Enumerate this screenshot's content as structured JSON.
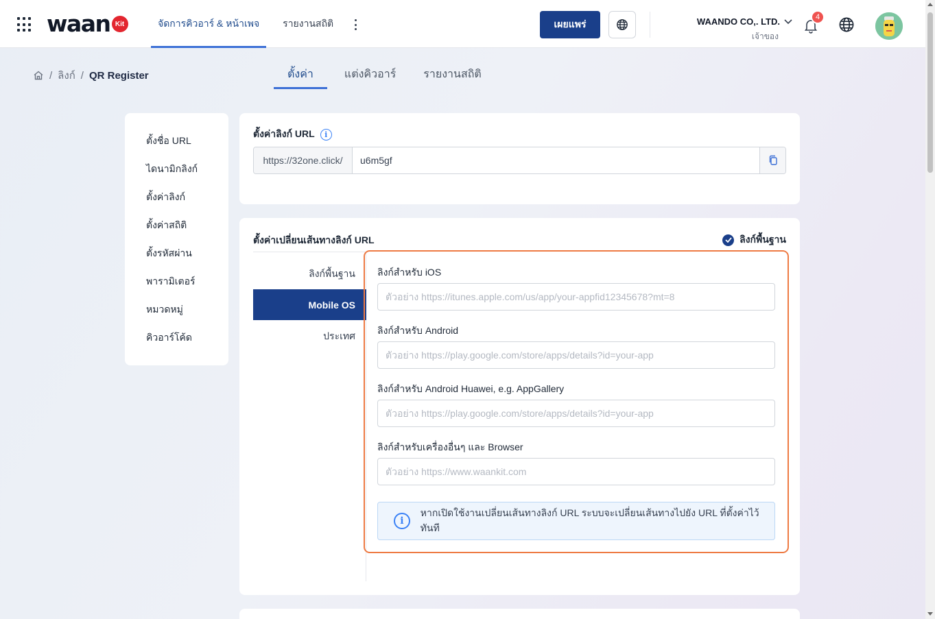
{
  "header": {
    "logo_text": "waan",
    "logo_badge": "Kit",
    "nav": [
      {
        "label": "จัดการคิวอาร์ & หน้าเพจ",
        "active": true
      },
      {
        "label": "รายงานสถิติ",
        "active": false
      }
    ],
    "publish_label": "เผยแพร่",
    "company_name": "WAANDO CO,. LTD.",
    "company_role": "เจ้าของ",
    "notification_count": "4"
  },
  "breadcrumb": {
    "items": [
      "ลิงก์",
      "QR Register"
    ]
  },
  "sub_tabs": [
    {
      "label": "ตั้งค่า",
      "active": true
    },
    {
      "label": "แต่งคิวอาร์",
      "active": false
    },
    {
      "label": "รายงานสถิติ",
      "active": false
    }
  ],
  "left_menu": [
    "ตั้งชื่อ URL",
    "ไดนามิกลิงก์",
    "ตั้งค่าลิงก์",
    "ตั้งค่าสถิติ",
    "ตั้งรหัสผ่าน",
    "พารามิเตอร์",
    "หมวดหมู่",
    "คิวอาร์โค้ด"
  ],
  "url_card": {
    "title": "ตั้งค่าลิงก์ URL",
    "prefix": "https://32one.click/",
    "slug": "u6m5gf"
  },
  "redirect_card": {
    "title": "ตั้งค่าเปลี่ยนเส้นทางลิงก์ URL",
    "basic_link_label": "ลิงก์พื้นฐาน",
    "tabs": [
      {
        "label": "ลิงก์พื้นฐาน",
        "active": false
      },
      {
        "label": "Mobile OS",
        "active": true
      },
      {
        "label": "ประเทศ",
        "active": false
      }
    ],
    "fields": [
      {
        "label": "ลิงก์สำหรับ iOS",
        "placeholder": "ตัวอย่าง https://itunes.apple.com/us/app/your-appfid12345678?mt=8",
        "value": ""
      },
      {
        "label": "ลิงก์สำหรับ Android",
        "placeholder": "ตัวอย่าง https://play.google.com/store/apps/details?id=your-app",
        "value": ""
      },
      {
        "label": "ลิงก์สำหรับ Android Huawei, e.g. AppGallery",
        "placeholder": "ตัวอย่าง https://play.google.com/store/apps/details?id=your-app",
        "value": ""
      },
      {
        "label": "ลิงก์สำหรับเครื่องอื่นๆ และ Browser",
        "placeholder": "ตัวอย่าง https://www.waankit.com",
        "value": ""
      }
    ],
    "info_message": "หากเปิดใช้งานเปลี่ยนเส้นทางลิงก์ URL ระบบจะเปลี่ยนเส้นทางไปยัง URL ที่ตั้งค่าไว้ทันที"
  },
  "icons": [
    "apps-grid-icon",
    "kebab-menu-icon",
    "globe-icon",
    "chevron-down-icon",
    "bell-icon",
    "home-icon",
    "info-icon",
    "copy-icon",
    "check-icon"
  ],
  "colors": {
    "primary": "#1a3f8a",
    "accent": "#3b6fd6",
    "highlight": "#ee7a43",
    "badge": "#ef5350"
  }
}
